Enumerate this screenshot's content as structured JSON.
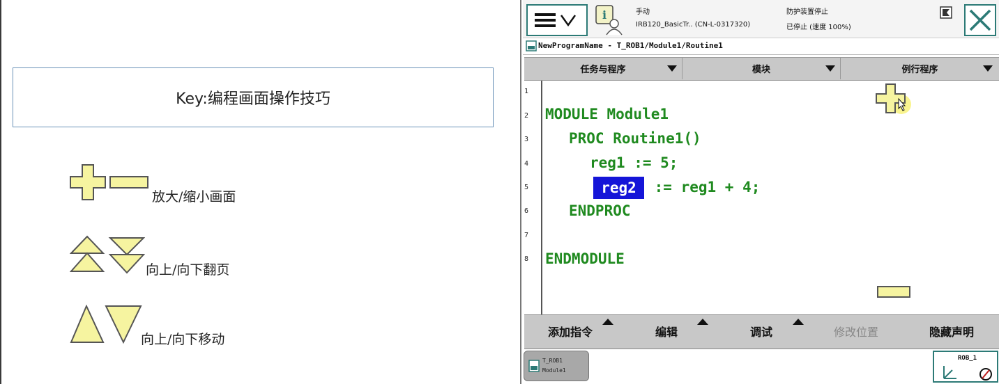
{
  "slide": {
    "key_title": "Key:编程画面操作技巧",
    "legend": [
      {
        "icon": "plus-minus-icon",
        "text": "放大/缩小画面"
      },
      {
        "icon": "double-triangle-icon",
        "text": "向上/向下翻页"
      },
      {
        "icon": "single-triangle-icon",
        "text": "向上/向下移动"
      }
    ]
  },
  "pendant": {
    "status": {
      "mode": "手动",
      "controller": "IRB120_BasicTr.. (CN-L-0317320)",
      "guard": "防护装置停止",
      "state": "已停止 (速度 100%)"
    },
    "path": "NewProgramName - T_ROB1/Module1/Routine1",
    "tabs": [
      "任务与程序",
      "模块",
      "例行程序"
    ],
    "code_lines": [
      {
        "no": "1",
        "text": ""
      },
      {
        "no": "2",
        "text": "MODULE Module1"
      },
      {
        "no": "3",
        "text": "PROC Routine1()"
      },
      {
        "no": "4",
        "text": "reg1 := 5;"
      },
      {
        "no": "5",
        "sel": "reg2",
        "rest": " := reg1 + 4;"
      },
      {
        "no": "6",
        "text": "ENDPROC"
      },
      {
        "no": "7",
        "text": ""
      },
      {
        "no": "8",
        "text": "ENDMODULE"
      }
    ],
    "bottom_menu": [
      "添加指令",
      "编辑",
      "调试",
      "修改位置",
      "隐藏声明"
    ],
    "task_button": {
      "line1": "T_ROB1",
      "line2": "Module1"
    },
    "rob_button": "ROB_1",
    "colors": {
      "code": "#1f8a1f",
      "selection": "#1515d8",
      "accent": "#2c7a76",
      "zoom_icon": "#f3f08a"
    }
  }
}
